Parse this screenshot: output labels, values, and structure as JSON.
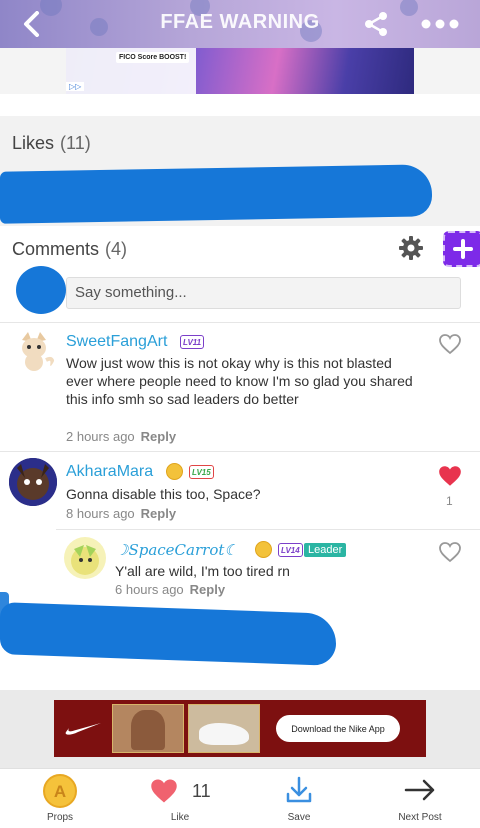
{
  "header": {
    "title": "FFAE WARNING"
  },
  "ad_top": {
    "badge_text": "FICO Score BOOST!",
    "adchoices": "▷▷"
  },
  "likes": {
    "label": "Likes",
    "count": "(11)"
  },
  "comments": {
    "label": "Comments",
    "count": "(4)",
    "input_placeholder": "Say something...",
    "items": [
      {
        "username": "SweetFangArt",
        "level": "LV11",
        "text": "Wow just wow this is not okay why is this not blasted ever where people need to know I'm so glad you shared this info smh so sad leaders do better",
        "time": "2 hours ago",
        "reply": "Reply",
        "liked": false
      },
      {
        "username": "AkharaMara",
        "level": "LV15",
        "text": "Gonna disable this too, Space?",
        "time": "8 hours ago",
        "reply": "Reply",
        "liked": true,
        "like_count": "1"
      },
      {
        "username": "SpaceCarrot",
        "level": "LV14",
        "role": "Leader",
        "text": "Y'all are wild, I'm too tired rn",
        "time": "6 hours ago",
        "reply": "Reply",
        "liked": false
      }
    ]
  },
  "ad_bottom": {
    "cta": "Download the Nike App"
  },
  "navbar": {
    "props": "Props",
    "like": "Like",
    "like_count": "11",
    "save": "Save",
    "next": "Next Post"
  },
  "colors": {
    "accent_purple": "#7d2ae8",
    "username_blue": "#2a9fd8",
    "heart_red": "#e8344e",
    "leader_teal": "#2bb5a3",
    "scribble_blue": "#1677d8"
  }
}
